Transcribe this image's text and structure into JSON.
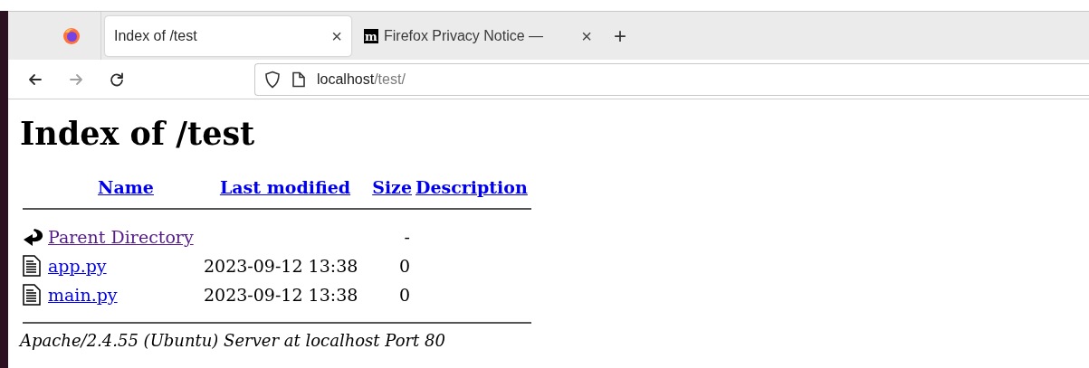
{
  "tabs": [
    {
      "kind": "page",
      "title": "Index of /test",
      "close": "×",
      "selected": true
    },
    {
      "kind": "mozilla",
      "favicon_text": "m",
      "title": "Firefox Privacy Notice —",
      "close": "×",
      "selected": false
    }
  ],
  "new_tab": "+",
  "nav": [
    {
      "kind": "back",
      "disabled": false
    },
    {
      "kind": "forward",
      "disabled": true
    },
    {
      "kind": "reload",
      "disabled": false
    }
  ],
  "address": {
    "host": "localhost",
    "path": "/test/"
  },
  "page": {
    "heading": "Index of /test",
    "columns": [
      "Name",
      "Last modified",
      "Size",
      "Description"
    ],
    "rows": [
      {
        "kind": "parent",
        "name": "Parent Directory",
        "visited": true,
        "size": "-"
      },
      {
        "kind": "file",
        "name": "app.py",
        "visited": false,
        "last_modified": "2023-09-12 13:38",
        "size": "0"
      },
      {
        "kind": "file",
        "name": "main.py",
        "visited": false,
        "last_modified": "2023-09-12 13:38",
        "size": "0"
      }
    ],
    "footer": "Apache/2.4.55 (Ubuntu) Server at localhost Port 80"
  }
}
